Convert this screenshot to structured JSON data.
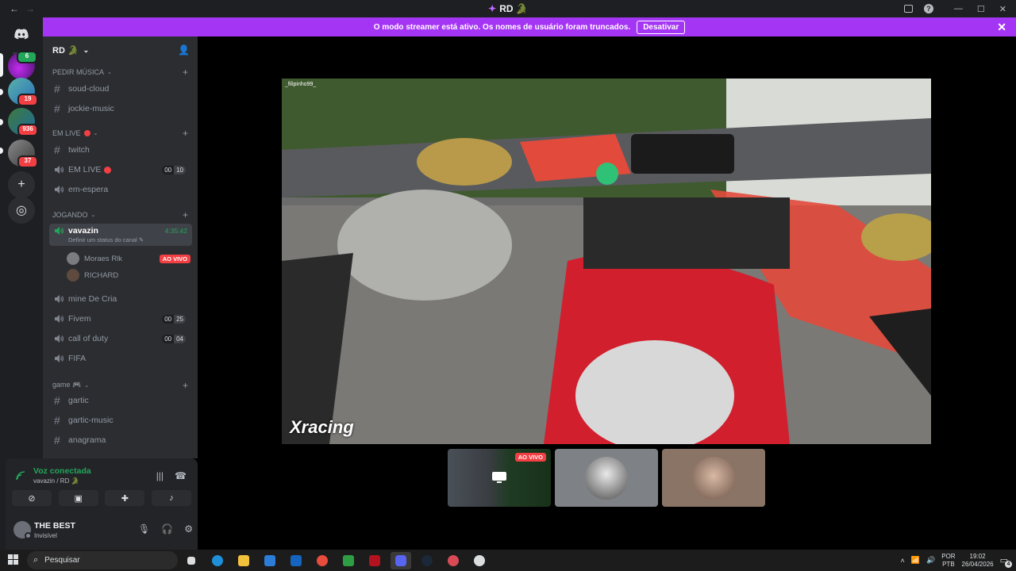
{
  "window": {
    "title": "RD 🐊"
  },
  "rail": {
    "badges": [
      "6",
      "19",
      "936",
      "37"
    ]
  },
  "banner": {
    "message": "O modo streamer está ativo. Os nomes de usuário foram truncados.",
    "button_label": "Desativar"
  },
  "guild": {
    "name": "RD 🐊"
  },
  "categories": {
    "pedir_musica": "PEDIR MÚSICA",
    "em_live": "EM LIVE",
    "jogando": "JOGANDO",
    "game": "game 🎮"
  },
  "channels": {
    "soud_cloud": "soud-cloud",
    "jockie_music": "jockie-music",
    "twitch": "twitch",
    "em_live": {
      "name": "EM LIVE",
      "count_a": "00",
      "count_b": "10"
    },
    "em_espera": "em-espera",
    "vavazin": {
      "name": "vavazin",
      "status": "Definir um status do canal",
      "timer": "4:35:42"
    },
    "mine_de_cria": "mine De Cria",
    "fivem": {
      "name": "Fivem",
      "count_a": "00",
      "count_b": "25"
    },
    "call_of_duty": {
      "name": "call of duty",
      "count_a": "00",
      "count_b": "04"
    },
    "fifa": "FIFA",
    "gartic": "gartic",
    "gartic_music": "gartic-music",
    "anagrama": "anagrama"
  },
  "voice_users": [
    {
      "name": "Moraes Rlk",
      "live_label": "AO VIVO"
    },
    {
      "name": "RICHARD"
    }
  ],
  "voice_panel": {
    "status": "Voz conectada",
    "location": "vavazin / RD 🐊"
  },
  "user": {
    "name": "THE BEST",
    "status": "Invisível"
  },
  "stream": {
    "ig_handle": "_filipinho99_",
    "brand": "Xracing"
  },
  "thumbnails": {
    "live_label": "AO VIVO"
  },
  "taskbar": {
    "search_placeholder": "Pesquisar",
    "lang_line1": "POR",
    "lang_line2": "PTB",
    "time": "19:02",
    "date": "26/04/2026",
    "notif_count": "4"
  },
  "colors": {
    "banner": "#a535f5",
    "voice_green": "#23a55a",
    "live_red": "#f23f43"
  }
}
